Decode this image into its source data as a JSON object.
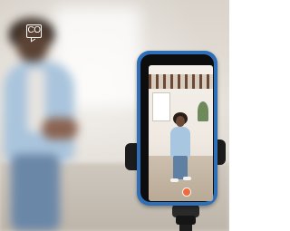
{
  "overlay": {
    "cc_label": "CO"
  },
  "icons": {
    "captions": "closed-captions-icon",
    "record": "record-button-icon"
  },
  "colors": {
    "phone_case": "#2e6fb8",
    "record_button": "#f26a3a"
  }
}
